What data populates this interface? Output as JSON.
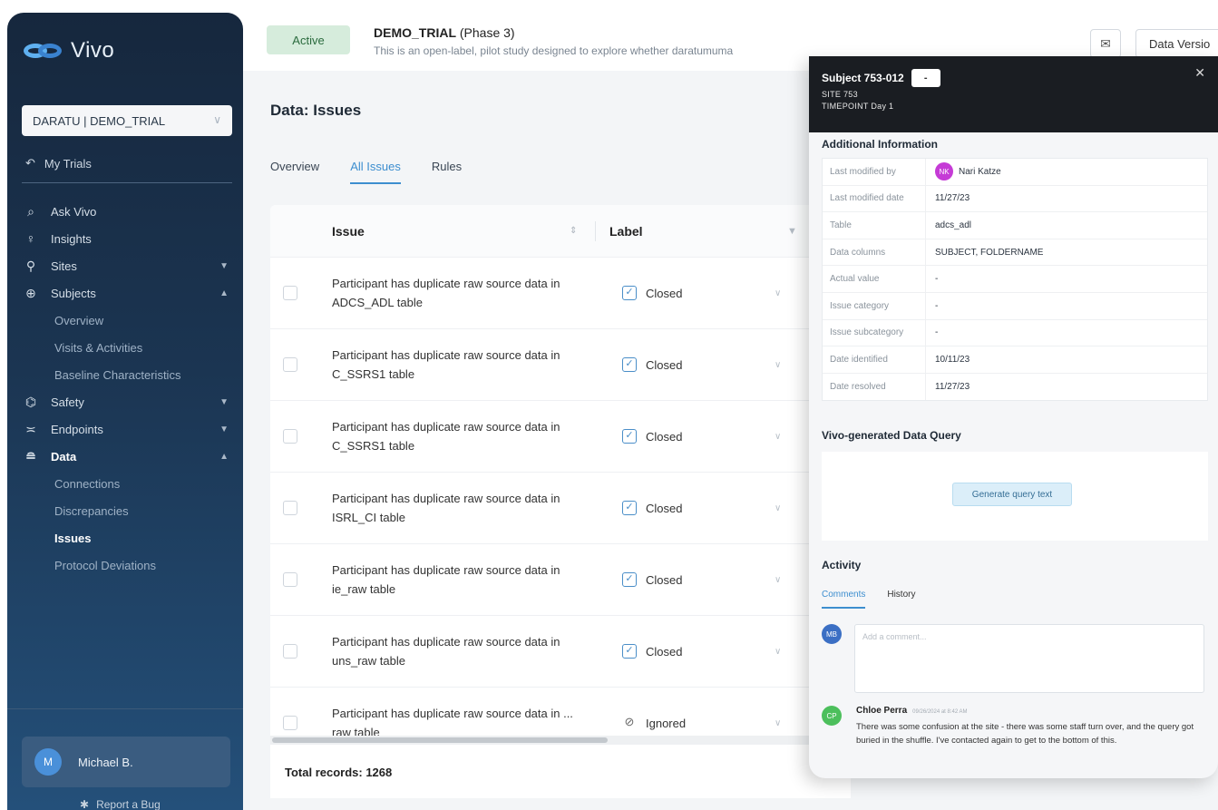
{
  "sidebar": {
    "logo_text": "Vivo",
    "trial_selector": "DARATU | DEMO_TRIAL",
    "my_trials": "My Trials",
    "items": [
      {
        "label": "Ask Vivo",
        "icon": "search-icon"
      },
      {
        "label": "Insights",
        "icon": "lightbulb-icon"
      },
      {
        "label": "Sites",
        "icon": "location-pin-icon",
        "expanded": false
      },
      {
        "label": "Subjects",
        "icon": "user-search-icon",
        "expanded": true,
        "children": [
          "Overview",
          "Visits & Activities",
          "Baseline Characteristics"
        ]
      },
      {
        "label": "Safety",
        "icon": "safety-icon",
        "expanded": false
      },
      {
        "label": "Endpoints",
        "icon": "endpoints-icon",
        "expanded": false
      },
      {
        "label": "Data",
        "icon": "database-icon",
        "expanded": true,
        "children": [
          "Connections",
          "Discrepancies",
          "Issues",
          "Protocol Deviations"
        ],
        "active_child": "Issues"
      }
    ],
    "user": {
      "initial": "M",
      "name": "Michael B."
    },
    "report_bug": "Report a Bug"
  },
  "header": {
    "status": "Active",
    "trial_name": "DEMO_TRIAL",
    "trial_phase": "(Phase 3)",
    "description": "This is an open-label, pilot study designed to explore whether daratumuma",
    "version_button": "Data Versio"
  },
  "page": {
    "title": "Data: Issues",
    "tabs": [
      "Overview",
      "All Issues",
      "Rules"
    ],
    "active_tab": "All Issues"
  },
  "table": {
    "columns": [
      "Issue",
      "Label"
    ],
    "rows": [
      {
        "issue": "Participant has duplicate raw source data in ADCS_ADL table",
        "label": "Closed"
      },
      {
        "issue": "Participant has duplicate raw source data in C_SSRS1 table",
        "label": "Closed"
      },
      {
        "issue": "Participant has duplicate raw source data in C_SSRS1 table",
        "label": "Closed"
      },
      {
        "issue": "Participant has duplicate raw source data in ISRL_CI table",
        "label": "Closed"
      },
      {
        "issue": "Participant has duplicate raw source data in ie_raw table",
        "label": "Closed"
      },
      {
        "issue": "Participant has duplicate raw source data in uns_raw table",
        "label": "Closed"
      },
      {
        "issue": "Participant has duplicate raw source data in ... raw table",
        "label": "Ignored"
      }
    ],
    "total_records": "Total records: 1268"
  },
  "panel": {
    "subject": "Subject 753-012",
    "subject_tag": "-",
    "site": "SITE  753",
    "timepoint": "TIMEPOINT  Day 1",
    "additional_info_title": "Additional Information",
    "info": [
      {
        "key": "Last modified by",
        "value": "Nari Katze",
        "avatar": "NK"
      },
      {
        "key": "Last modified date",
        "value": "11/27/23"
      },
      {
        "key": "Table",
        "value": "adcs_adl"
      },
      {
        "key": "Data columns",
        "value": "SUBJECT, FOLDERNAME"
      },
      {
        "key": "Actual value",
        "value": "-"
      },
      {
        "key": "Issue category",
        "value": "-"
      },
      {
        "key": "Issue subcategory",
        "value": "-"
      },
      {
        "key": "Date identified",
        "value": "10/11/23"
      },
      {
        "key": "Date resolved",
        "value": "11/27/23"
      }
    ],
    "query_title": "Vivo-generated Data Query",
    "generate_button": "Generate query text",
    "activity_title": "Activity",
    "activity_tabs": [
      "Comments",
      "History"
    ],
    "comment_placeholder": "Add a comment...",
    "my_initials": "MB",
    "comment": {
      "initials": "CP",
      "author": "Chloe Perra",
      "timestamp": "09/26/2024 at 8:42 AM",
      "text": "There was some confusion at the site - there was some staff turn over, and the query got buried in the shuffle. I've contacted again to get to the bottom of this."
    }
  },
  "colors": {
    "sidebar_top": "#16273d",
    "sidebar_bottom": "#24507a",
    "accent": "#3d8ecf",
    "active_pill": "#d6ecdc",
    "panel_header": "#1a1d22"
  }
}
